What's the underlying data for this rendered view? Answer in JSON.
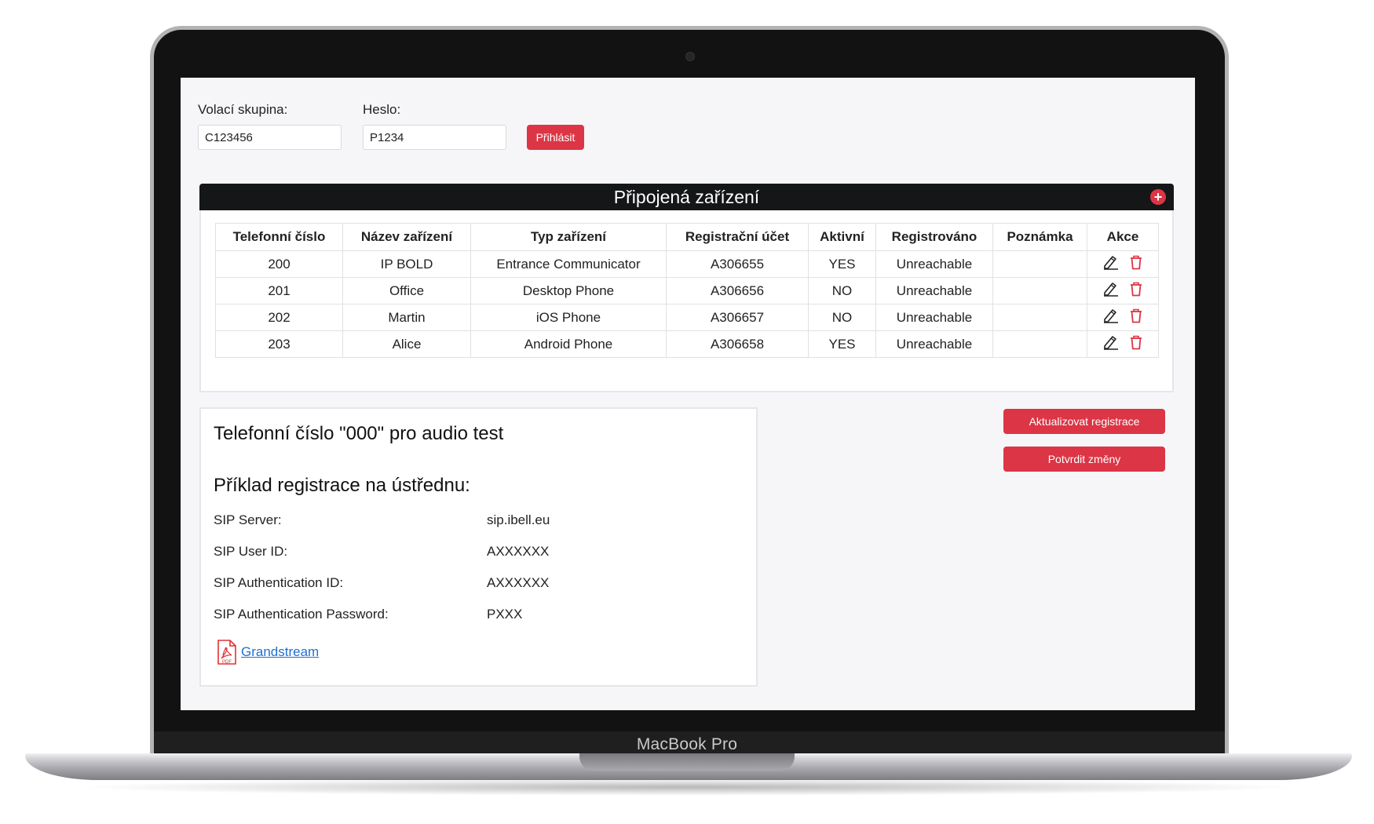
{
  "device_brand": "MacBook Pro",
  "login": {
    "group_label": "Volací skupina:",
    "group_value": "C123456",
    "password_label": "Heslo:",
    "password_value": "P1234",
    "login_button": "Přihlásit"
  },
  "devices": {
    "title": "Připojená zařízení",
    "add_icon": "plus-circle-icon",
    "columns": [
      "Telefonní číslo",
      "Název zařízení",
      "Typ zařízení",
      "Registrační účet",
      "Aktivní",
      "Registrováno",
      "Poznámka",
      "Akce"
    ],
    "rows": [
      {
        "number": "200",
        "name": "IP BOLD",
        "type": "Entrance Communicator",
        "account": "A306655",
        "active": "YES",
        "registered": "Unreachable",
        "note": ""
      },
      {
        "number": "201",
        "name": "Office",
        "type": "Desktop Phone",
        "account": "A306656",
        "active": "NO",
        "registered": "Unreachable",
        "note": ""
      },
      {
        "number": "202",
        "name": "Martin",
        "type": "iOS Phone",
        "account": "A306657",
        "active": "NO",
        "registered": "Unreachable",
        "note": ""
      },
      {
        "number": "203",
        "name": "Alice",
        "type": "Android Phone",
        "account": "A306658",
        "active": "YES",
        "registered": "Unreachable",
        "note": ""
      }
    ],
    "row_icons": [
      "edit-icon",
      "trash-icon"
    ]
  },
  "actions": {
    "refresh_button": "Aktualizovat registrace",
    "confirm_button": "Potvrdit změny"
  },
  "info": {
    "audio_test": "Telefonní číslo \"000\" pro audio test",
    "example_title": "Příklad registrace na ústřednu:",
    "fields": [
      {
        "label": "SIP Server:",
        "value": "sip.ibell.eu"
      },
      {
        "label": "SIP User ID:",
        "value": "AXXXXXX"
      },
      {
        "label": "SIP Authentication ID:",
        "value": "AXXXXXX"
      },
      {
        "label": "SIP Authentication Password:",
        "value": "PXXX"
      }
    ],
    "pdf_icon": "pdf-icon",
    "pdf_icon_text": "PDF",
    "link_text": "Grandstream"
  },
  "colors": {
    "accent": "#dc3545",
    "header_bg": "#151617",
    "link": "#1f6fd0"
  }
}
